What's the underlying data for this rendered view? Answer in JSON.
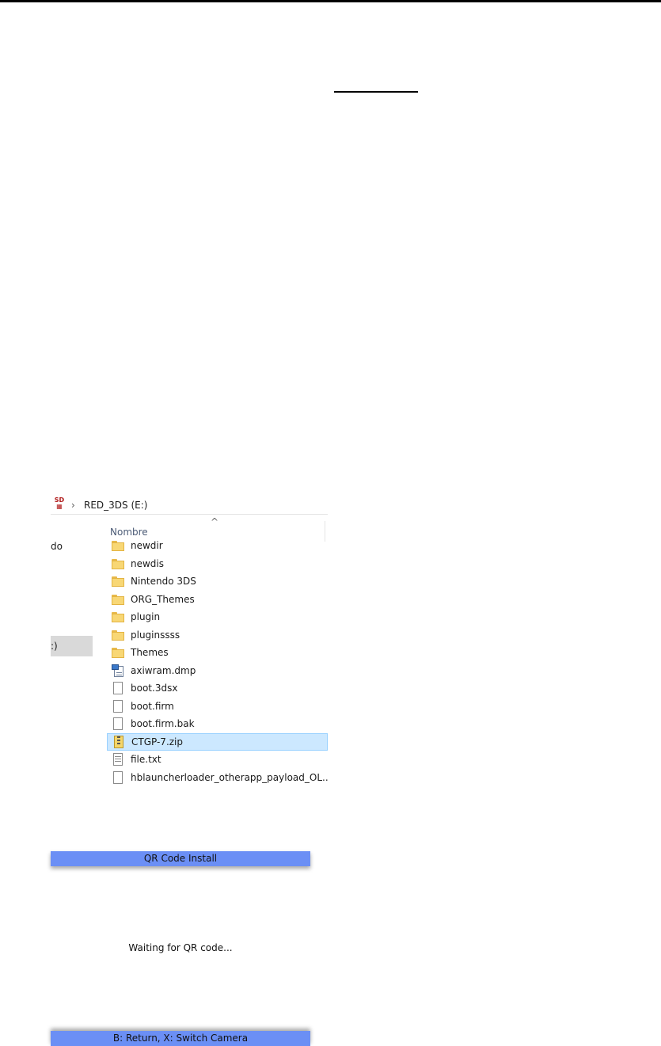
{
  "explorer": {
    "address": {
      "drive_icon_text": "SD",
      "path": "RED_3DS (E:)"
    },
    "nav_items": [
      "do",
      ":)"
    ],
    "sort_caret": "^",
    "column_header": "Nombre",
    "selected_index": 11,
    "files": [
      {
        "name": "newdir",
        "type": "folder"
      },
      {
        "name": "newdis",
        "type": "folder"
      },
      {
        "name": "Nintendo 3DS",
        "type": "folder"
      },
      {
        "name": "ORG_Themes",
        "type": "folder"
      },
      {
        "name": "plugin",
        "type": "folder"
      },
      {
        "name": "pluginssss",
        "type": "folder"
      },
      {
        "name": "Themes",
        "type": "folder"
      },
      {
        "name": "axiwram.dmp",
        "type": "dmp"
      },
      {
        "name": "boot.3dsx",
        "type": "file"
      },
      {
        "name": "boot.firm",
        "type": "file"
      },
      {
        "name": "boot.firm.bak",
        "type": "file"
      },
      {
        "name": "CTGP-7.zip",
        "type": "zip"
      },
      {
        "name": "file.txt",
        "type": "txt"
      },
      {
        "name": "hblauncherloader_otherapp_payload_OL...",
        "type": "file"
      }
    ]
  },
  "qr_install": {
    "title": "QR Code Install",
    "status": "Waiting for QR code...",
    "footer": "B: Return, X: Switch Camera"
  },
  "colors": {
    "bar_blue": "#6b8ff5",
    "selection": "#cce8ff",
    "folder": "#f8d775"
  }
}
